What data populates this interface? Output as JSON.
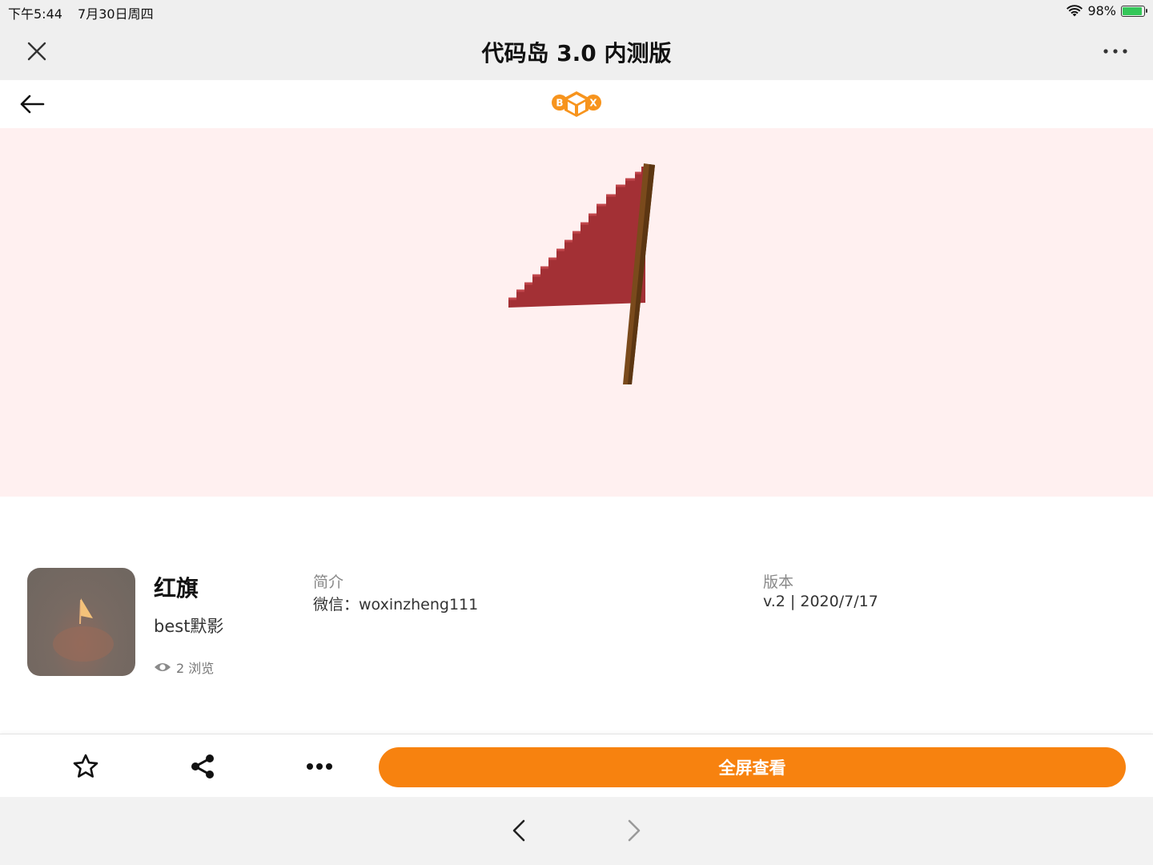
{
  "status_bar": {
    "time": "下午5:44",
    "date": "7月30日周四",
    "battery": "98%",
    "battery_level": 0.98
  },
  "title_bar": {
    "title": "代码岛 3.0 内测版"
  },
  "nav_bar": {
    "logo_letters": [
      "B",
      "X"
    ]
  },
  "project": {
    "title": "红旗",
    "author": "best默影",
    "views": "2 浏览",
    "intro_label": "简介",
    "intro_text": "微信：woxinzheng111",
    "version_label": "版本",
    "version_text": "v.2 | 2020/7/17"
  },
  "actions": {
    "fullscreen_label": "全屏查看"
  },
  "colors": {
    "accent": "#f7820f",
    "flag": "#a33035",
    "pole": "#7a4a1c",
    "viewer_bg": "#fff0f0"
  }
}
